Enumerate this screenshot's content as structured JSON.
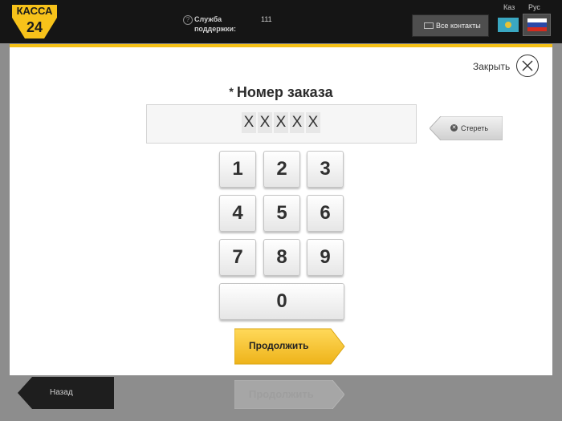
{
  "header": {
    "logo_top": "КАССА",
    "logo_bottom": "24",
    "support_label": "Служба поддержки:",
    "support_phone": "111",
    "contacts_label": "Все контакты",
    "languages": {
      "kz": "Каз",
      "ru": "Рус",
      "selected": "ru"
    }
  },
  "modal": {
    "close_label": "Закрыть",
    "field_required_marker": "*",
    "field_title": "Номер заказа",
    "order_input_chars": [
      "X",
      "X",
      "X",
      "X",
      "X"
    ],
    "erase_label": "Стереть",
    "keypad": [
      "1",
      "2",
      "3",
      "4",
      "5",
      "6",
      "7",
      "8",
      "9",
      "0"
    ],
    "continue_label": "Продолжить"
  },
  "background_page": {
    "back_label": "Назад",
    "continue_label": "Продолжить"
  },
  "colors": {
    "accent": "#f5c016",
    "topbar": "#151515",
    "overlay": "#8d8d8d"
  }
}
